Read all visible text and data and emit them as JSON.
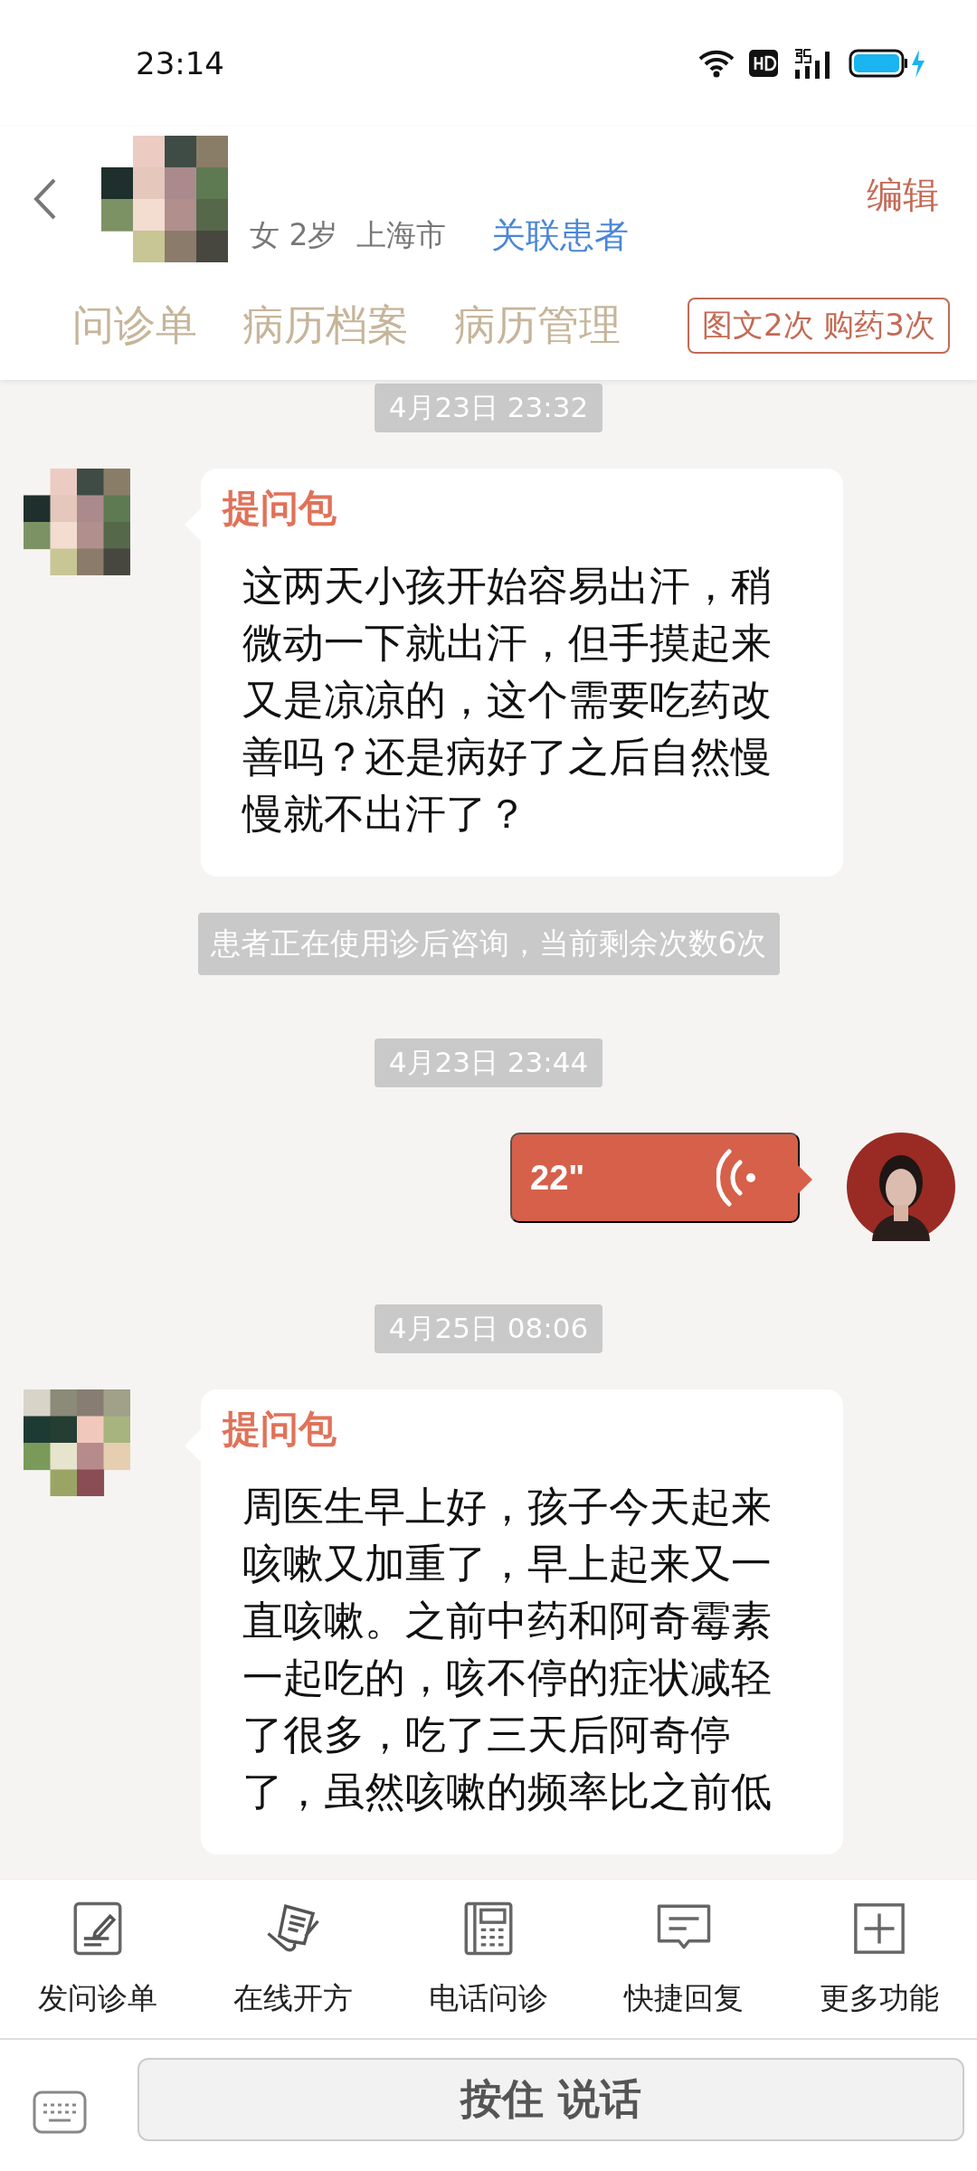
{
  "status_bar": {
    "time": "23:14"
  },
  "patient": {
    "info": "女 2岁",
    "city": "上海市",
    "link": "关联患者",
    "edit": "编辑"
  },
  "tabs": [
    {
      "label": "问诊单"
    },
    {
      "label": "病历档案"
    },
    {
      "label": "病历管理"
    }
  ],
  "quota_badge": "图文2次 购药3次",
  "messages": [
    {
      "kind": "timestamp",
      "text": "4月23日 23:32"
    },
    {
      "kind": "question",
      "title": "提问包",
      "text": "这两天小孩开始容易出汗，稍微动一下就出汗，但手摸起来又是凉凉的，这个需要吃药改善吗？还是病好了之后自然慢慢就不出汗了？"
    },
    {
      "kind": "notice",
      "text": "患者正在使用诊后咨询，当前剩余次数6次"
    },
    {
      "kind": "timestamp",
      "text": "4月23日 23:44"
    },
    {
      "kind": "voice",
      "duration": "22\""
    },
    {
      "kind": "timestamp",
      "text": "4月25日 08:06"
    },
    {
      "kind": "question",
      "title": "提问包",
      "text": "周医生早上好，孩子今天起来咳嗽又加重了，早上起来又一直咳嗽。之前中药和阿奇霉素一起吃的，咳不停的症状减轻了很多，吃了三天后阿奇停了，虽然咳嗽的频率比之前低"
    }
  ],
  "toolbar": [
    {
      "label": "发问诊单"
    },
    {
      "label": "在线开方"
    },
    {
      "label": "电话问诊"
    },
    {
      "label": "快捷回复"
    },
    {
      "label": "更多功能"
    }
  ],
  "voice_input": {
    "label": "按住 说话"
  }
}
